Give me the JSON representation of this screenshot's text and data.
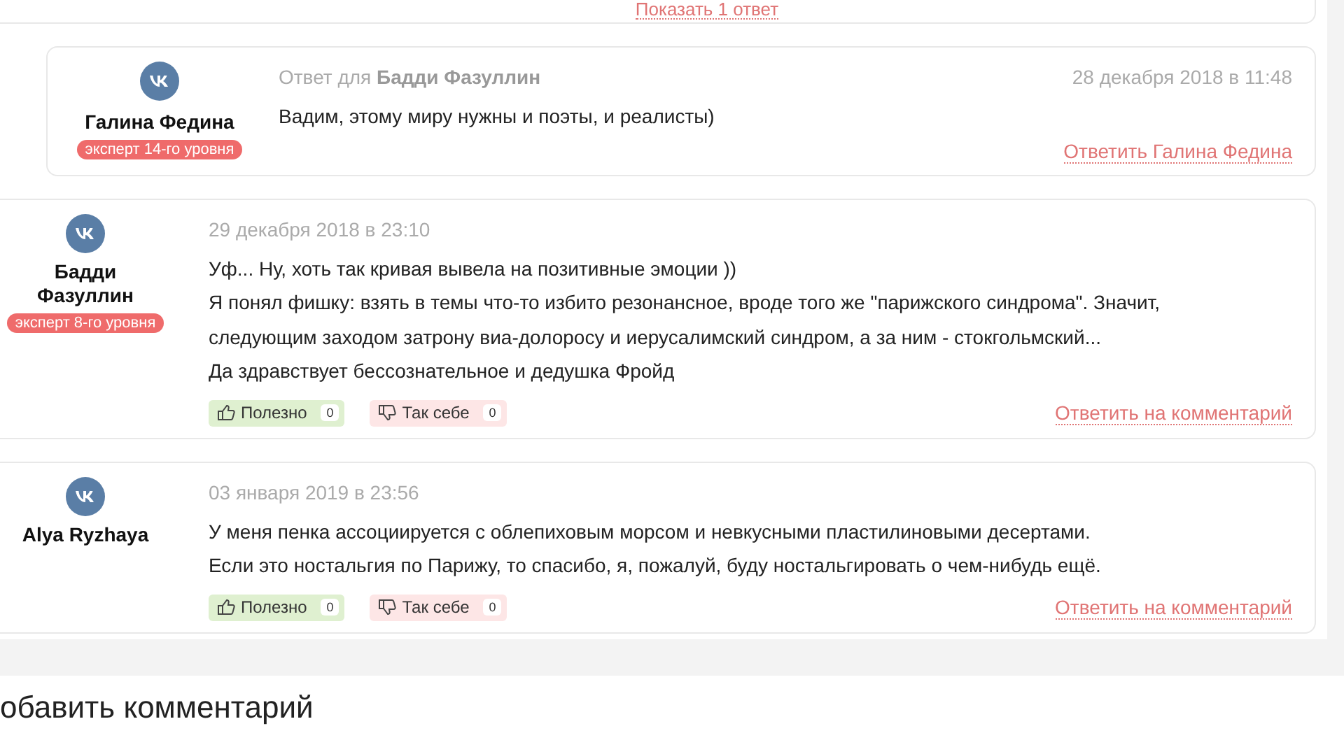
{
  "show_replies_link": "Показать 1 ответ",
  "comments": [
    {
      "kind": "reply",
      "author": "Галина Федина",
      "badge": "эксперт 14-го уровня",
      "header": "Ответ для **Бадди Фазуллин**",
      "date": "28 декабря 2018 в 11:48",
      "lines": [
        "Вадим, этому миру нужны и поэты, и реалисты)"
      ],
      "reply_link": "Ответить Галина Федина"
    },
    {
      "kind": "comment",
      "author": "Бадди Фазуллин",
      "badge": "эксперт 8-го уровня",
      "date": "29 декабря 2018 в 23:10",
      "lines": [
        "Уф... Ну, хоть так кривая вывела на позитивные эмоции ))",
        "Я понял фишку: взять в темы что-то избито резонансное, вроде того же \"парижского синдрома\". Значит,",
        "следующим заходом затрону виа-долоросу и иерусалимский синдром, а за ним - стокгольмский...",
        "Да здравствует бессознательное и дедушка Фройд"
      ],
      "votes": [
        {
          "kind": "up",
          "label": "Полезно",
          "count": "0"
        },
        {
          "kind": "down",
          "label": "Так себе",
          "count": "0"
        }
      ],
      "reply_link": "Ответить на комментарий"
    },
    {
      "kind": "comment",
      "author": "Alya Ryzhaya",
      "date": "03 января 2019 в 23:56",
      "lines": [
        "У меня пенка ассоциируется с облепиховым морсом и невкусными пластилиновыми десертами.",
        "Если это ностальгия по Парижу, то спасибо, я, пожалуй, буду ностальгировать о чем-нибудь ещё."
      ],
      "votes": [
        {
          "kind": "up",
          "label": "Полезно",
          "count": "0"
        },
        {
          "kind": "down",
          "label": "Так себе",
          "count": "0"
        }
      ],
      "reply_link": "Ответить на комментарий"
    }
  ],
  "add_comment_title": "обавить комментарий"
}
